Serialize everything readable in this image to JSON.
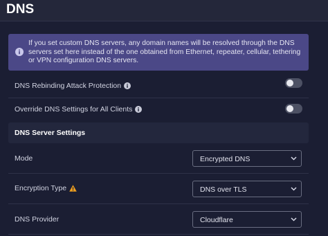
{
  "header": {
    "title": "DNS"
  },
  "notice": {
    "text": "If you set custom DNS servers, any domain names will be resolved through the DNS servers set here instead of the one obtained from Ethernet, repeater, cellular, tethering or VPN configuration DNS servers."
  },
  "settings": {
    "rebinding": {
      "label": "DNS Rebinding Attack Protection",
      "enabled": false
    },
    "override": {
      "label": "Override DNS Settings for All Clients",
      "enabled": false
    }
  },
  "server_settings": {
    "title": "DNS Server Settings",
    "mode": {
      "label": "Mode",
      "value": "Encrypted DNS"
    },
    "encryption": {
      "label": "Encryption Type",
      "value": "DNS over TLS"
    },
    "provider": {
      "label": "DNS Provider",
      "value": "Cloudflare"
    }
  },
  "colors": {
    "background": "#1b1e33",
    "notice_bg": "#4b4887",
    "warning": "#f0a020",
    "toggle_off": "#4d5164"
  }
}
